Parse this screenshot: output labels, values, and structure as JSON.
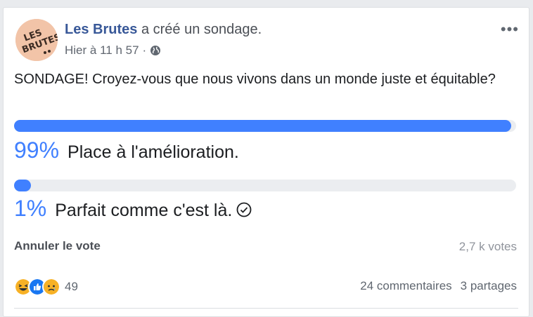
{
  "post": {
    "author": "Les Brutes",
    "action": "a créé un sondage.",
    "timestamp": "Hier à 11 h 57",
    "meta_separator": "·",
    "privacy_icon": "globe-icon",
    "more_icon": "more-horizontal-icon",
    "avatar_text": "LES BRUTES"
  },
  "poll": {
    "question": "SONDAGE! Croyez-vous que nous vivons dans un monde juste et équitable?",
    "options": [
      {
        "percent_label": "99%",
        "label": "Place à l'amélioration.",
        "fill_fraction": 0.99,
        "selected": false
      },
      {
        "percent_label": "1%",
        "label": "Parfait comme c'est là.",
        "fill_fraction": 0.01,
        "selected": true
      }
    ],
    "cancel_label": "Annuler le vote",
    "votes": "2,7 k votes"
  },
  "footer": {
    "reactions": [
      "haha-icon",
      "like-icon",
      "sad-icon"
    ],
    "reaction_count": "49",
    "comments": "24 commentaires",
    "shares": "3 partages"
  },
  "colors": {
    "accent": "#4080ff",
    "link": "#385898",
    "track": "#ebedf0"
  }
}
